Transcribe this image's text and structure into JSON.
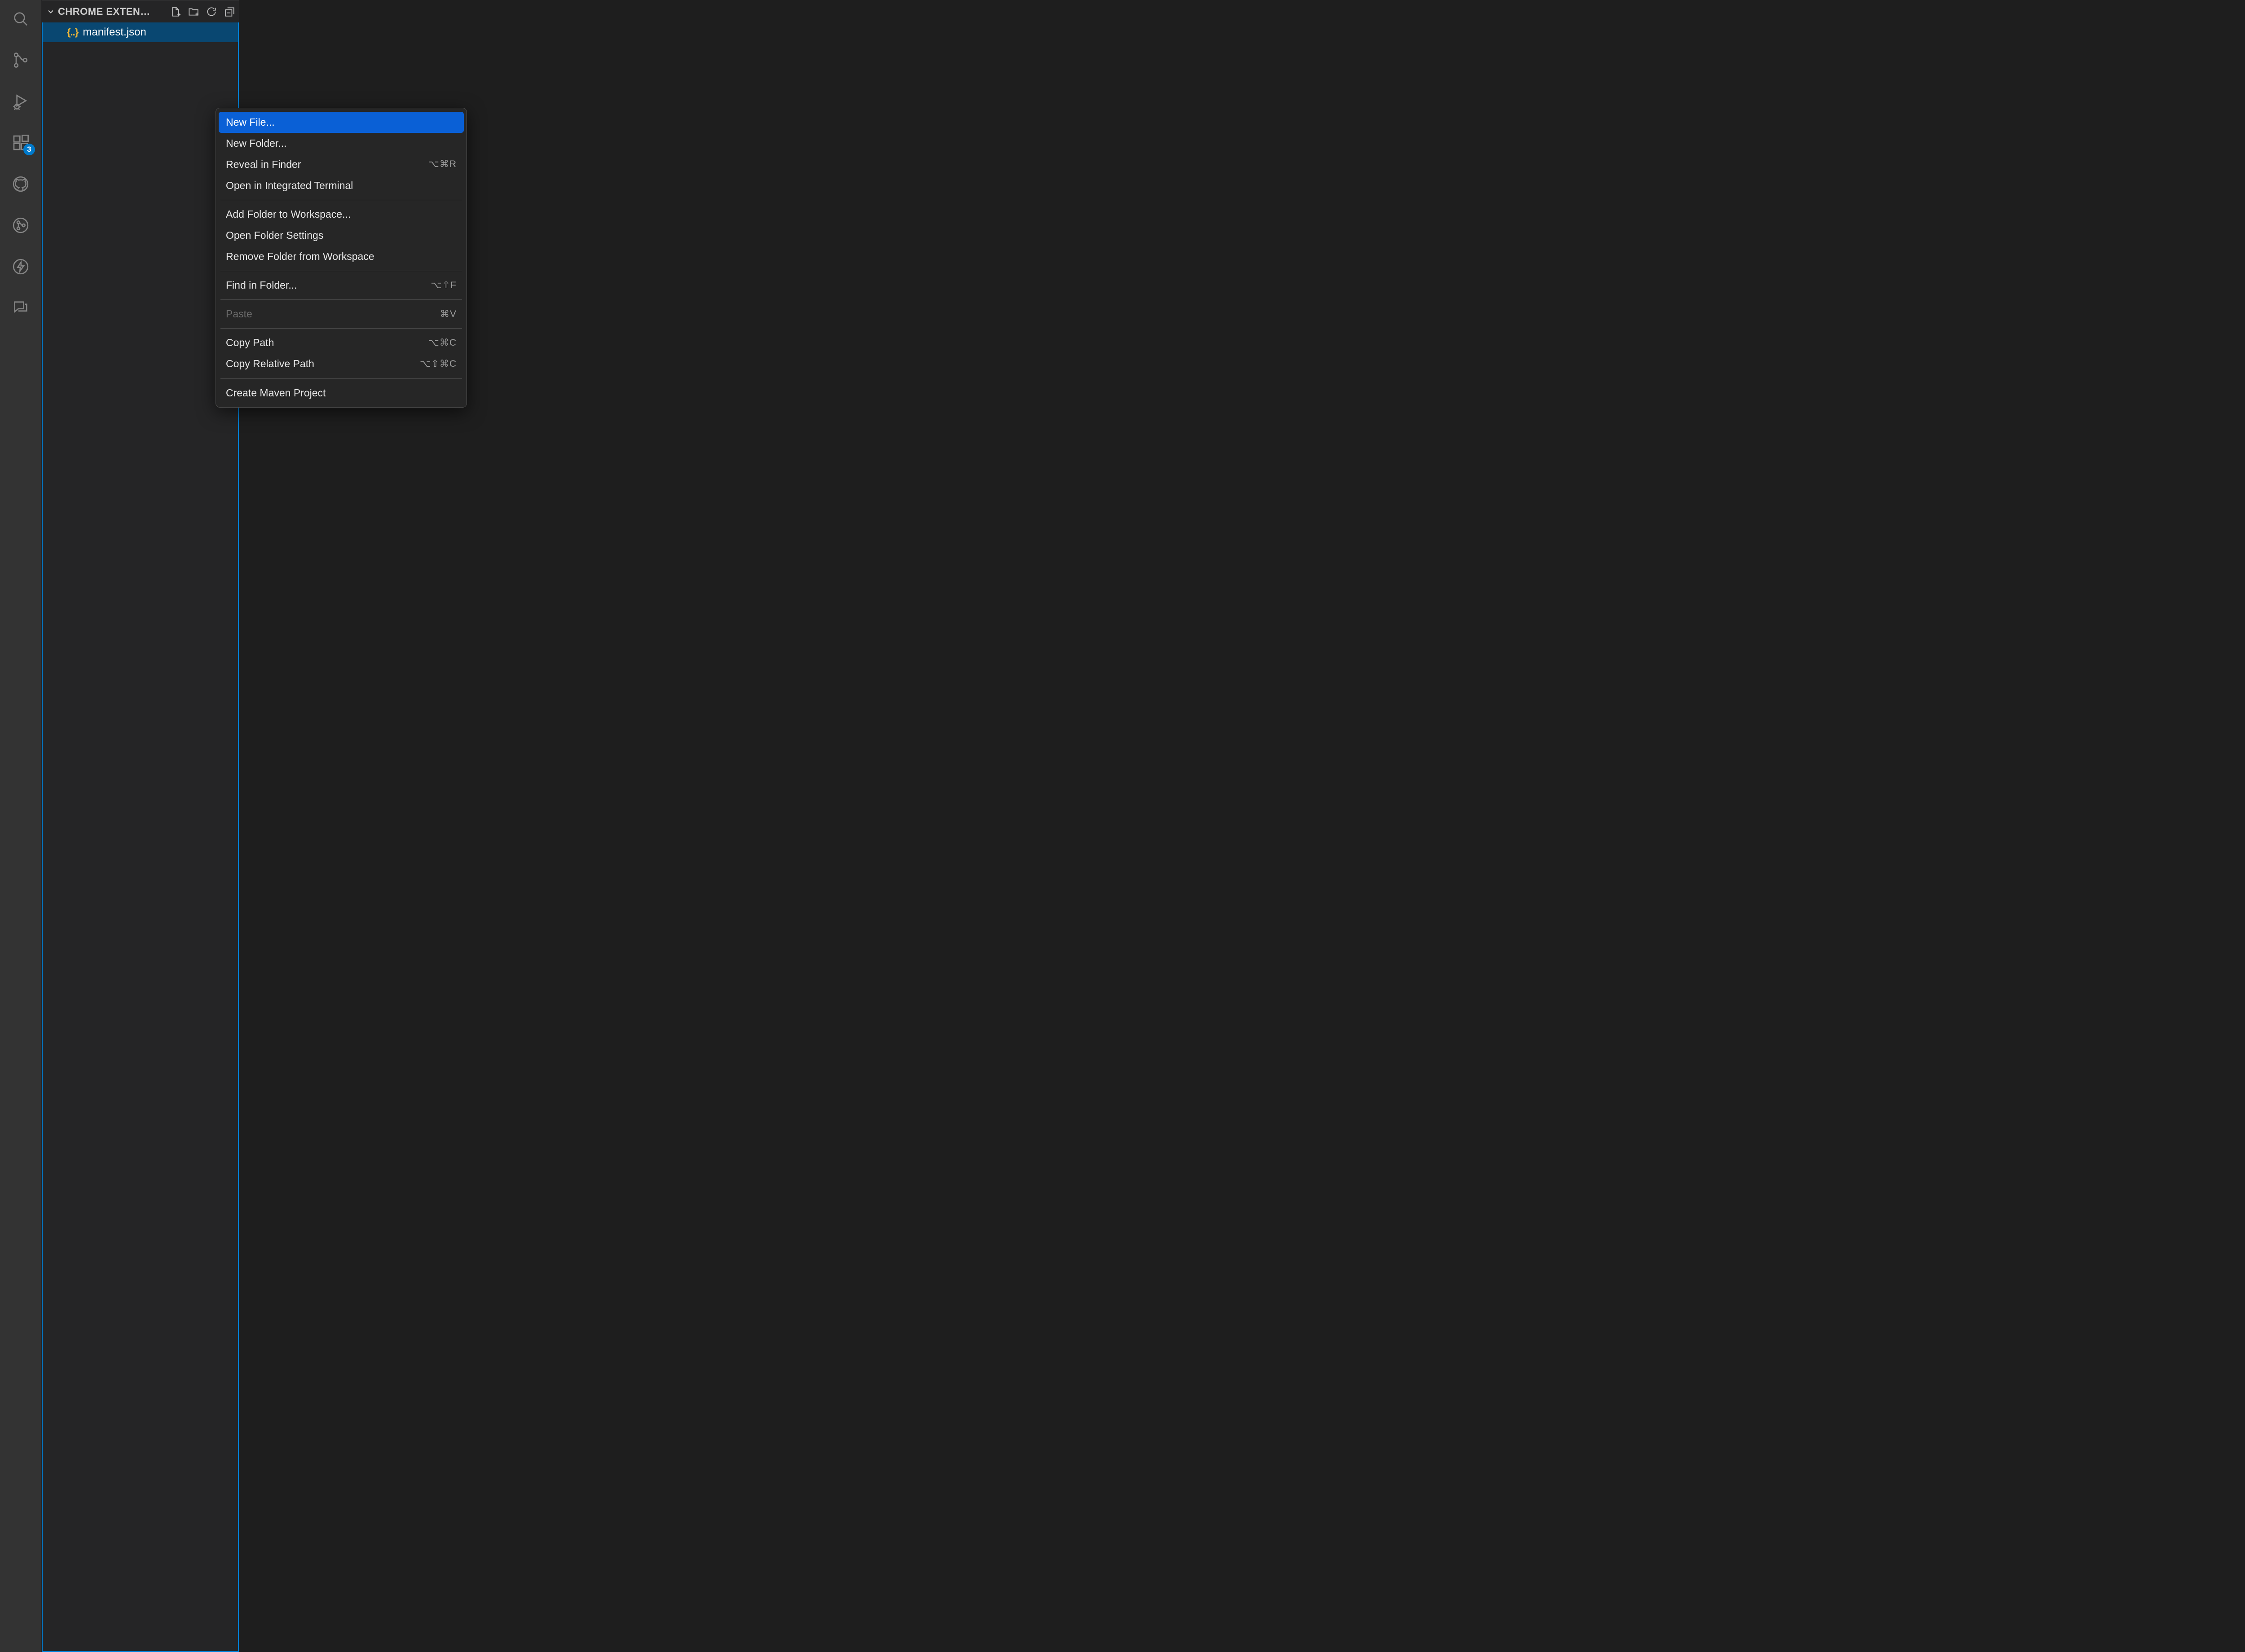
{
  "activity_bar": {
    "items": [
      {
        "name": "search"
      },
      {
        "name": "source-control"
      },
      {
        "name": "run-debug"
      },
      {
        "name": "extensions",
        "badge": "3"
      },
      {
        "name": "github"
      },
      {
        "name": "git-graph"
      },
      {
        "name": "actions"
      },
      {
        "name": "comments"
      }
    ]
  },
  "explorer": {
    "header_title": "CHROME EXTEN…",
    "actions": [
      "new-file",
      "new-folder",
      "refresh",
      "collapse-all"
    ],
    "tree": [
      {
        "label": "manifest.json",
        "icon": "json",
        "selected": true
      }
    ]
  },
  "context_menu": {
    "groups": [
      [
        {
          "label": "New File...",
          "selected": true
        },
        {
          "label": "New Folder..."
        },
        {
          "label": "Reveal in Finder",
          "shortcut": "⌥⌘R"
        },
        {
          "label": "Open in Integrated Terminal"
        }
      ],
      [
        {
          "label": "Add Folder to Workspace..."
        },
        {
          "label": "Open Folder Settings"
        },
        {
          "label": "Remove Folder from Workspace"
        }
      ],
      [
        {
          "label": "Find in Folder...",
          "shortcut": "⌥⇧F"
        }
      ],
      [
        {
          "label": "Paste",
          "shortcut": "⌘V",
          "disabled": true
        }
      ],
      [
        {
          "label": "Copy Path",
          "shortcut": "⌥⌘C"
        },
        {
          "label": "Copy Relative Path",
          "shortcut": "⌥⇧⌘C"
        }
      ],
      [
        {
          "label": "Create Maven Project"
        }
      ]
    ]
  }
}
